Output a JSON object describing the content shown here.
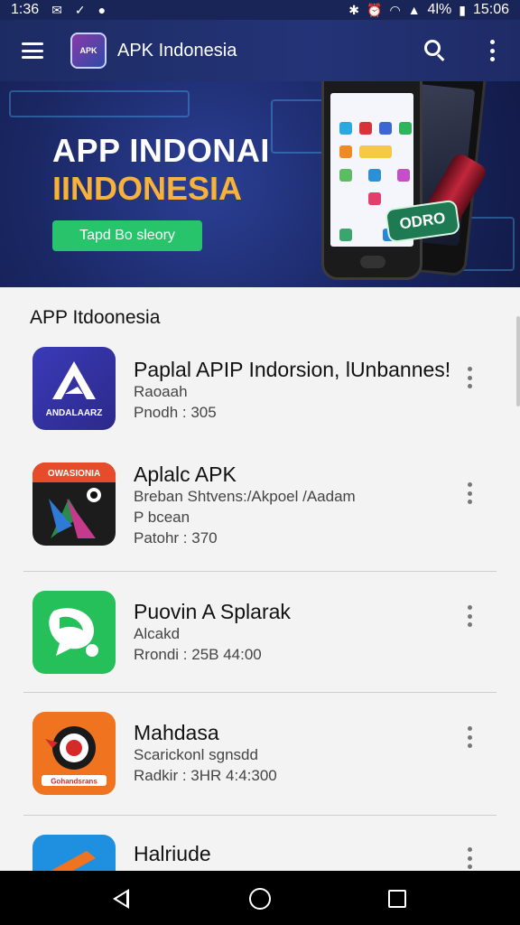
{
  "status_bar": {
    "time_left": "1:36",
    "time_right": "15:06",
    "battery": "4l%"
  },
  "app_bar": {
    "logo_text": "APK",
    "title": "APK Indonesia"
  },
  "banner": {
    "title": "APP INDONAI",
    "subtitle": "IINDONESIA",
    "button_label": "Tapd Bo sleory",
    "sticker_text": "ODRO"
  },
  "section": {
    "title": "APP Itdoonesia"
  },
  "apps": [
    {
      "name": "Paplal APIP Indorsion, lUnbannes!",
      "line1": "Raoaah",
      "line2": "Pnodh : 305",
      "icon_text": "ANDALAARZ",
      "icon": "andalaarz-app-icon"
    },
    {
      "name": "Aplalc APK",
      "line1": "Breban Shtvens:/Akpoel /Aadam",
      "line2": "P bcean",
      "line3": "Patohr : 370",
      "icon_text": "OWASIONIA",
      "icon": "owasionia-app-icon"
    },
    {
      "name": "Puovin A Splarak",
      "line1": "Alcakd",
      "line2": "Rrondi : 25B  44:00",
      "icon": "chat-bubble-app-icon"
    },
    {
      "name": "Mahdasa",
      "line1": "Scarickonl sgnsdd",
      "line2": "Radkir : 3HR  4:4:300",
      "icon_text": "Gohandsrans",
      "icon": "target-app-icon"
    },
    {
      "name": "Halriude",
      "icon": "blue-app-icon"
    }
  ],
  "colors": {
    "app_bar": "#1d2b63",
    "banner_button": "#27c46c",
    "banner_subtitle": "#f6b23a"
  }
}
